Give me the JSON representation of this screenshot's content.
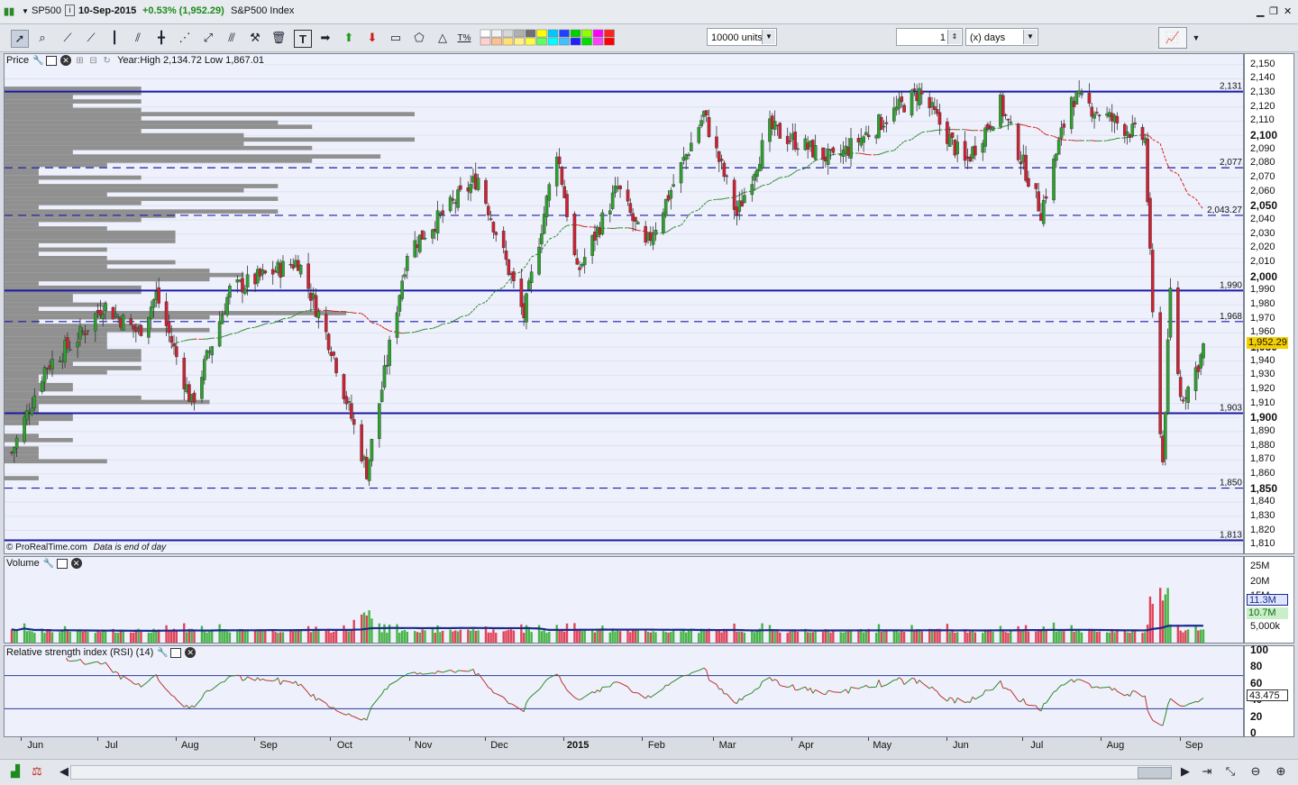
{
  "titlebar": {
    "symbol": "SP500",
    "date": "10-Sep-2015",
    "change": "+0.53% (1,952.29)",
    "name": "S&P500 Index"
  },
  "toolbar": {
    "units_value": "10000 units",
    "period_value": "1",
    "period_unit": "(x) days"
  },
  "price_panel": {
    "label": "Price",
    "info": "Year:High 2,134.72 Low 1,867.01",
    "credit": "© ProRealTime.com",
    "credit_note": "Data is end of day",
    "last_price": "1,952.29",
    "levels": [
      {
        "value": 2131,
        "label": "2,131",
        "style": "solid"
      },
      {
        "value": 2077,
        "label": "2,077",
        "style": "dashed"
      },
      {
        "value": 2043.27,
        "label": "2,043.27",
        "style": "dashed"
      },
      {
        "value": 1990,
        "label": "1,990",
        "style": "solid"
      },
      {
        "value": 1968,
        "label": "1,968",
        "style": "dashed"
      },
      {
        "value": 1903,
        "label": "1,903",
        "style": "solid"
      },
      {
        "value": 1850,
        "label": "1,850",
        "style": "dashed"
      },
      {
        "value": 1813,
        "label": "1,813",
        "style": "solid"
      }
    ],
    "axis_ticks": [
      "2,150",
      "2,140",
      "2,130",
      "2,120",
      "2,110",
      "2,100",
      "2,090",
      "2,080",
      "2,070",
      "2,060",
      "2,050",
      "2,040",
      "2,030",
      "2,020",
      "2,010",
      "2,000",
      "1,990",
      "1,980",
      "1,970",
      "1,960",
      "1,950",
      "1,940",
      "1,930",
      "1,920",
      "1,910",
      "1,900",
      "1,890",
      "1,880",
      "1,870",
      "1,860",
      "1,850",
      "1,840",
      "1,830",
      "1,820",
      "1,810"
    ],
    "bold_ticks": [
      "2,100",
      "2,050",
      "2,000",
      "1,950",
      "1,900",
      "1,850"
    ]
  },
  "volume_panel": {
    "label": "Volume",
    "axis_ticks": [
      "25M",
      "20M",
      "15M",
      "5,000k"
    ],
    "avg_tag": "11.3M",
    "last_tag": "10.7M"
  },
  "rsi_panel": {
    "label": "Relative strength index (RSI) (14)",
    "axis_ticks": [
      "100",
      "80",
      "60",
      "40",
      "20",
      "0"
    ],
    "last_tag": "43.475",
    "upper": 70,
    "lower": 30
  },
  "x_axis": {
    "months": [
      "Jun",
      "Jul",
      "Aug",
      "Sep",
      "Oct",
      "Nov",
      "Dec",
      "2015",
      "Feb",
      "Mar",
      "Apr",
      "May",
      "Jun",
      "Jul",
      "Aug",
      "Sep"
    ]
  },
  "colors": {
    "up": "#2ea02e",
    "down": "#cc2233",
    "level_line": "#1a1aa6",
    "profile": "#8a8a8a",
    "ma_up": "#2e8b2e",
    "ma_down": "#d42020",
    "vol_avg": "#1a2a8c",
    "rsi_line": "#c03030",
    "price_tag": "#f5d000"
  },
  "chart_data": {
    "type": "candlestick",
    "title": "S&P500 Index",
    "frequency": "daily",
    "ylim": [
      1805,
      2155
    ],
    "series": [
      {
        "name": "Price",
        "anchors": [
          {
            "date": "2014-05-28",
            "close": 1875
          },
          {
            "date": "2014-06-10",
            "close": 1935
          },
          {
            "date": "2014-06-25",
            "close": 1960
          },
          {
            "date": "2014-07-03",
            "close": 1980
          },
          {
            "date": "2014-07-17",
            "close": 1960
          },
          {
            "date": "2014-07-24",
            "close": 1987
          },
          {
            "date": "2014-08-07",
            "close": 1910
          },
          {
            "date": "2014-08-22",
            "close": 1990
          },
          {
            "date": "2014-09-18",
            "close": 2011
          },
          {
            "date": "2014-10-01",
            "close": 1950
          },
          {
            "date": "2014-10-15",
            "close": 1862
          },
          {
            "date": "2014-10-31",
            "close": 2018
          },
          {
            "date": "2014-11-28",
            "close": 2070
          },
          {
            "date": "2014-12-16",
            "close": 1972
          },
          {
            "date": "2014-12-29",
            "close": 2090
          },
          {
            "date": "2015-01-06",
            "close": 2002
          },
          {
            "date": "2015-01-22",
            "close": 2063
          },
          {
            "date": "2015-02-02",
            "close": 2020
          },
          {
            "date": "2015-02-25",
            "close": 2115
          },
          {
            "date": "2015-03-10",
            "close": 2044
          },
          {
            "date": "2015-03-23",
            "close": 2105
          },
          {
            "date": "2015-04-17",
            "close": 2082
          },
          {
            "date": "2015-05-21",
            "close": 2131
          },
          {
            "date": "2015-06-08",
            "close": 2080
          },
          {
            "date": "2015-06-22",
            "close": 2122
          },
          {
            "date": "2015-07-08",
            "close": 2046
          },
          {
            "date": "2015-07-20",
            "close": 2128
          },
          {
            "date": "2015-08-18",
            "close": 2097
          },
          {
            "date": "2015-08-21",
            "close": 1971
          },
          {
            "date": "2015-08-25",
            "close": 1868
          },
          {
            "date": "2015-08-28",
            "close": 1989
          },
          {
            "date": "2015-09-01",
            "close": 1914
          },
          {
            "date": "2015-09-04",
            "close": 1921
          },
          {
            "date": "2015-09-09",
            "close": 1943
          },
          {
            "date": "2015-09-10",
            "close": 1952.29
          }
        ]
      }
    ],
    "volume_ylim": [
      0,
      27000000
    ],
    "rsi_ylim": [
      0,
      100
    ]
  }
}
